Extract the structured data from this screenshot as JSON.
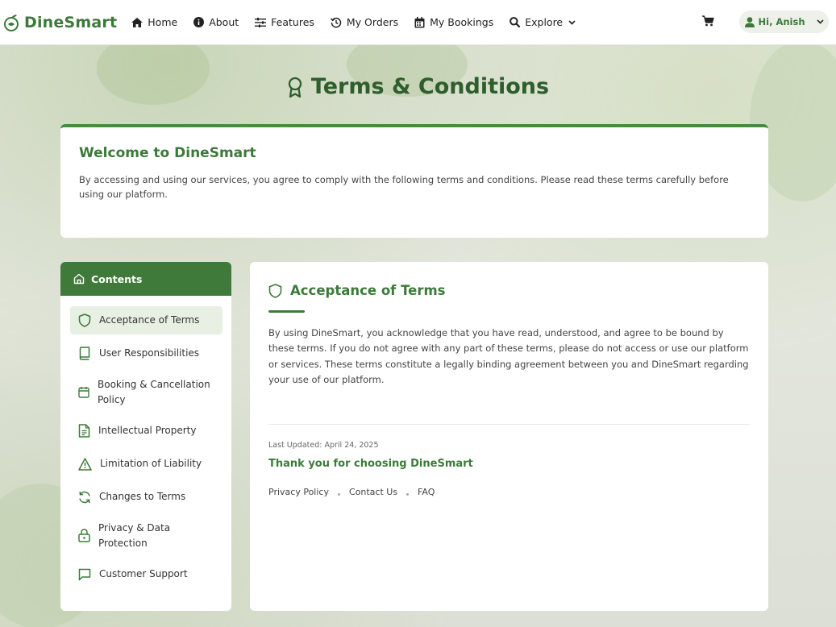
{
  "nav": {
    "brand": "DineSmart",
    "items": [
      {
        "label": "Home",
        "icon": "home-icon"
      },
      {
        "label": "About",
        "icon": "info-icon"
      },
      {
        "label": "Features",
        "icon": "sliders-icon"
      },
      {
        "label": "My Orders",
        "icon": "history-icon"
      },
      {
        "label": "My Bookings",
        "icon": "calendar-icon"
      },
      {
        "label": "Explore",
        "icon": "search-icon"
      }
    ],
    "cart_icon": "cart-icon",
    "user_greeting": "Hi, Anish"
  },
  "page": {
    "title": "Terms & Conditions"
  },
  "welcome": {
    "heading": "Welcome to DineSmart",
    "text": "By accessing and using our services, you agree to comply with the following terms and conditions. Please read these terms carefully before using our platform."
  },
  "sidebar": {
    "heading": "Contents",
    "items": [
      {
        "label": "Acceptance of Terms",
        "icon": "shield-icon",
        "active": true
      },
      {
        "label": "User Responsibilities",
        "icon": "book-icon"
      },
      {
        "label": "Booking & Cancellation Policy",
        "icon": "calendar-icon"
      },
      {
        "label": "Intellectual Property",
        "icon": "document-icon"
      },
      {
        "label": "Limitation of Liability",
        "icon": "warning-icon"
      },
      {
        "label": "Changes to Terms",
        "icon": "refresh-icon"
      },
      {
        "label": "Privacy & Data Protection",
        "icon": "lock-icon"
      },
      {
        "label": "Customer Support",
        "icon": "chat-icon"
      }
    ]
  },
  "section": {
    "title": "Acceptance of Terms",
    "body": "By using DineSmart, you acknowledge that you have read, understood, and agree to be bound by these terms. If you do not agree with any part of these terms, please do not access or use our platform or services. These terms constitute a legally binding agreement between you and DineSmart regarding your use of our platform."
  },
  "footer": {
    "updated": "Last Updated: April 24, 2025",
    "thanks": "Thank you for choosing DineSmart",
    "links": [
      "Privacy Policy",
      "Contact Us",
      "FAQ"
    ]
  },
  "colors": {
    "brand": "#3c7a3a",
    "brand_dark": "#2e5e2c",
    "active_bg": "#e8f0e3"
  }
}
